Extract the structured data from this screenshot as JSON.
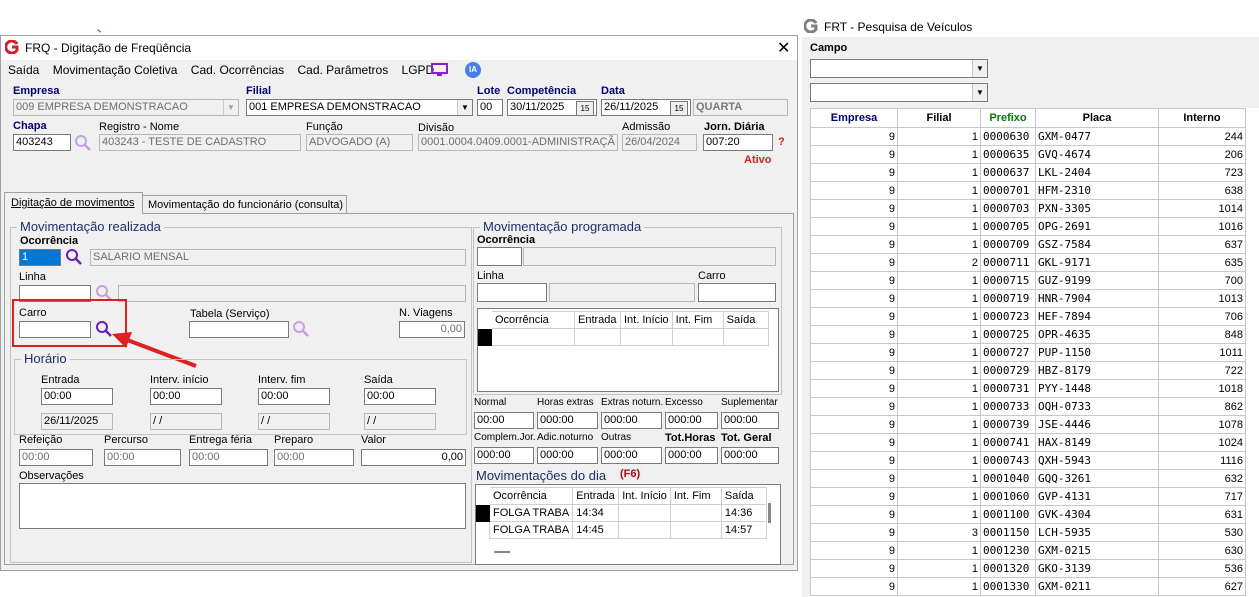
{
  "main_window": {
    "title": "FRQ - Digitação de Freqüência",
    "menu": [
      "Saída",
      "Movimentação Coletiva",
      "Cad. Ocorrências",
      "Cad. Parâmetros",
      "LGPD"
    ],
    "ia_label": "IA"
  },
  "header": {
    "empresa_label": "Empresa",
    "empresa_value": "009 EMPRESA DEMONSTRACAO",
    "filial_label": "Filial",
    "filial_value": "001 EMPRESA DEMONSTRACAO",
    "lote_label": "Lote",
    "lote_value": "00",
    "competencia_label": "Competência",
    "competencia_value": "30/11/2025",
    "data_label": "Data",
    "data_value": "26/11/2025",
    "weekday": "QUARTA",
    "chapa_label": "Chapa",
    "chapa_value": "403243",
    "registro_label": "Registro - Nome",
    "registro_value": "403243 - TESTE DE CADASTRO",
    "funcao_label": "Função",
    "funcao_value": "ADVOGADO (A)",
    "divisao_label": "Divisão",
    "divisao_value": "0001.0004.0409.0001-ADMINISTRAÇÃ",
    "admissao_label": "Admissão",
    "admissao_value": "26/04/2024",
    "jornada_label": "Jorn. Diária",
    "jornada_value": "007:20",
    "help": "?",
    "status": "Ativo",
    "cal_icon": "15"
  },
  "tabs": [
    "Digitação de movimentos",
    "Movimentação do funcionário (consulta)"
  ],
  "realizada": {
    "title": "Movimentação realizada",
    "ocorrencia_label": "Ocorrência",
    "ocorrencia_code": "1",
    "ocorrencia_desc": "SALARIO MENSAL",
    "linha_label": "Linha",
    "carro_label": "Carro",
    "tabela_label": "Tabela (Serviço)",
    "viagens_label": "N. Viagens",
    "viagens_value": "0,00",
    "horario_title": "Horário",
    "entrada_label": "Entrada",
    "entrada_value": "00:00",
    "entrada_date": "26/11/2025",
    "interv_inicio_label": "Interv. início",
    "interv_inicio_value": "00:00",
    "interv_inicio_date": "/ /",
    "interv_fim_label": "Interv. fim",
    "interv_fim_value": "00:00",
    "interv_fim_date": "/ /",
    "saida_label": "Saída",
    "saida_value": "00:00",
    "saida_date": "/ /",
    "refeicao_label": "Refeição",
    "refeicao_value": "00:00",
    "percurso_label": "Percurso",
    "percurso_value": "00:00",
    "entrega_label": "Entrega féria",
    "entrega_value": "00:00",
    "preparo_label": "Preparo",
    "preparo_value": "00:00",
    "valor_label": "Valor",
    "valor_value": "0,00",
    "obs_label": "Observações"
  },
  "programada": {
    "title": "Movimentação programada",
    "ocorrencia_label": "Ocorrência",
    "linha_label": "Linha",
    "carro_label": "Carro",
    "grid_headers": [
      "Ocorrência",
      "Entrada",
      "Int. Início",
      "Int. Fim",
      "Saída"
    ],
    "totals": [
      {
        "label": "Normal",
        "value": "00:00"
      },
      {
        "label": "Horas extras",
        "value": "000:00"
      },
      {
        "label": "Extras noturn.",
        "value": "000:00"
      },
      {
        "label": "Excesso",
        "value": "000:00"
      },
      {
        "label": "Suplementar",
        "value": "000:00"
      },
      {
        "label": "Complem.Jor.",
        "value": "000:00"
      },
      {
        "label": "Adic.noturno",
        "value": "000:00"
      },
      {
        "label": "Outras",
        "value": "000:00"
      },
      {
        "label": "Tot.Horas",
        "value": "000:00"
      },
      {
        "label": "Tot. Geral",
        "value": "000:00"
      }
    ],
    "dia_title": "Movimentações do dia",
    "dia_shortcut": "(F6)",
    "dia_headers": [
      "Ocorrência",
      "Entrada",
      "Int. Início",
      "Int. Fim",
      "Saída"
    ],
    "dia_rows": [
      [
        "FOLGA TRABA",
        "14:34",
        "",
        "",
        "14:36"
      ],
      [
        "FOLGA TRABA",
        "14:45",
        "",
        "",
        "14:57"
      ]
    ]
  },
  "vehicle_window": {
    "title": "FRT - Pesquisa de Veículos",
    "campo_label": "Campo",
    "headers": [
      "Empresa",
      "Filial",
      "Prefixo",
      "Placa",
      "Interno"
    ],
    "header_colors": [
      "#00006e",
      "#000000",
      "#0a7a0a",
      "#000000",
      "#000000"
    ],
    "rows": [
      [
        "9",
        "1",
        "0000630",
        "GXM-0477",
        "244"
      ],
      [
        "9",
        "1",
        "0000635",
        "GVQ-4674",
        "206"
      ],
      [
        "9",
        "1",
        "0000637",
        "LKL-2404",
        "723"
      ],
      [
        "9",
        "1",
        "0000701",
        "HFM-2310",
        "638"
      ],
      [
        "9",
        "1",
        "0000703",
        "PXN-3305",
        "1014"
      ],
      [
        "9",
        "1",
        "0000705",
        "OPG-2691",
        "1016"
      ],
      [
        "9",
        "1",
        "0000709",
        "GSZ-7584",
        "637"
      ],
      [
        "9",
        "2",
        "0000711",
        "GKL-9171",
        "635"
      ],
      [
        "9",
        "1",
        "0000715",
        "GUZ-9199",
        "700"
      ],
      [
        "9",
        "1",
        "0000719",
        "HNR-7904",
        "1013"
      ],
      [
        "9",
        "1",
        "0000723",
        "HEF-7894",
        "706"
      ],
      [
        "9",
        "1",
        "0000725",
        "OPR-4635",
        "848"
      ],
      [
        "9",
        "1",
        "0000727",
        "PUP-1150",
        "1011"
      ],
      [
        "9",
        "1",
        "0000729",
        "HBZ-8179",
        "722"
      ],
      [
        "9",
        "1",
        "0000731",
        "PYY-1448",
        "1018"
      ],
      [
        "9",
        "1",
        "0000733",
        "OQH-0733",
        "862"
      ],
      [
        "9",
        "1",
        "0000739",
        "JSE-4446",
        "1078"
      ],
      [
        "9",
        "1",
        "0000741",
        "HAX-8149",
        "1024"
      ],
      [
        "9",
        "1",
        "0000743",
        "QXH-5943",
        "1116"
      ],
      [
        "9",
        "1",
        "0001040",
        "GQQ-3261",
        "632"
      ],
      [
        "9",
        "1",
        "0001060",
        "GVP-4131",
        "717"
      ],
      [
        "9",
        "1",
        "0001100",
        "GVK-4304",
        "631"
      ],
      [
        "9",
        "3",
        "0001150",
        "LCH-5935",
        "530"
      ],
      [
        "9",
        "1",
        "0001230",
        "GXM-0215",
        "630"
      ],
      [
        "9",
        "1",
        "0001320",
        "GKO-3139",
        "536"
      ],
      [
        "9",
        "1",
        "0001330",
        "GXM-0211",
        "627"
      ]
    ]
  },
  "colors": {
    "highlight": "#e02020",
    "link_blue": "#1f2e6a",
    "search_icon": "#6a1fb0"
  }
}
